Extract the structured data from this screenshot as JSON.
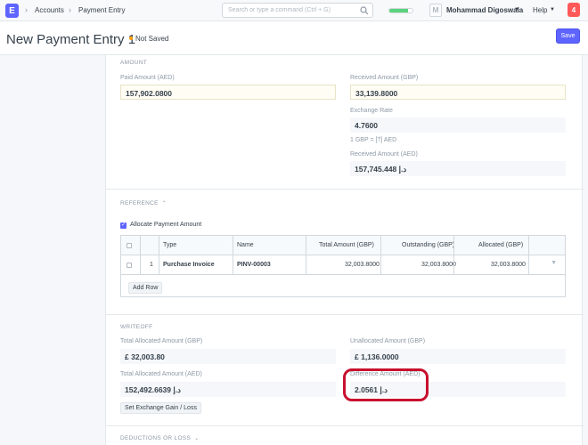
{
  "navbar": {
    "logo": "E",
    "breadcrumbs": [
      "Accounts",
      "Payment Entry"
    ],
    "search_placeholder": "Search or type a command (Ctrl + G)",
    "progress": 0.8,
    "avatar_initial": "M",
    "user_name": "Mohammad Digoswala",
    "help_label": "Help",
    "notification_count": "4"
  },
  "page": {
    "title": "New Payment Entry 1",
    "status": "Not Saved",
    "save_label": "Save"
  },
  "amount_section": {
    "heading": "AMOUNT",
    "paid_amount_label": "Paid Amount (AED)",
    "paid_amount": "157,902.0800",
    "received_amount_label": "Received Amount (GBP)",
    "received_amount": "33,139.8000",
    "exchange_rate_label": "Exchange Rate",
    "exchange_rate": "4.7600",
    "conversion_note": "1 GBP = [?] AED",
    "received_aed_label": "Received Amount (AED)",
    "received_aed": "157,745.448 د.إ"
  },
  "reference_section": {
    "heading": "REFERENCE",
    "allocate_label": "Allocate Payment Amount",
    "columns": [
      "Type",
      "Name",
      "Total Amount (GBP)",
      "Outstanding (GBP)",
      "Allocated (GBP)"
    ],
    "rows": [
      {
        "idx": "1",
        "type": "Purchase Invoice",
        "name": "PINV-00003",
        "total": "32,003.8000",
        "outstanding": "32,003.8000",
        "allocated": "32,003.8000"
      }
    ],
    "add_row_label": "Add Row"
  },
  "writeoff_section": {
    "heading": "WRITEOFF",
    "total_allocated_gbp_label": "Total Allocated Amount (GBP)",
    "total_allocated_gbp": "£ 32,003.80",
    "unallocated_label": "Unallocated Amount (GBP)",
    "unallocated": "£ 1,136.0000",
    "total_allocated_aed_label": "Total Allocated Amount (AED)",
    "total_allocated_aed": "152,492.6639 د.إ",
    "difference_label": "Difference Amount (AED)",
    "difference": "2.0561 د.إ",
    "exchange_button_label": "Set Exchange Gain / Loss"
  },
  "deductions_section": {
    "heading": "DEDUCTIONS OR LOSS"
  },
  "colors": {
    "primary": "#5e64ff",
    "warning_dot": "#ffa00a",
    "notification": "#ff5858",
    "highlight": "#c8102e"
  }
}
